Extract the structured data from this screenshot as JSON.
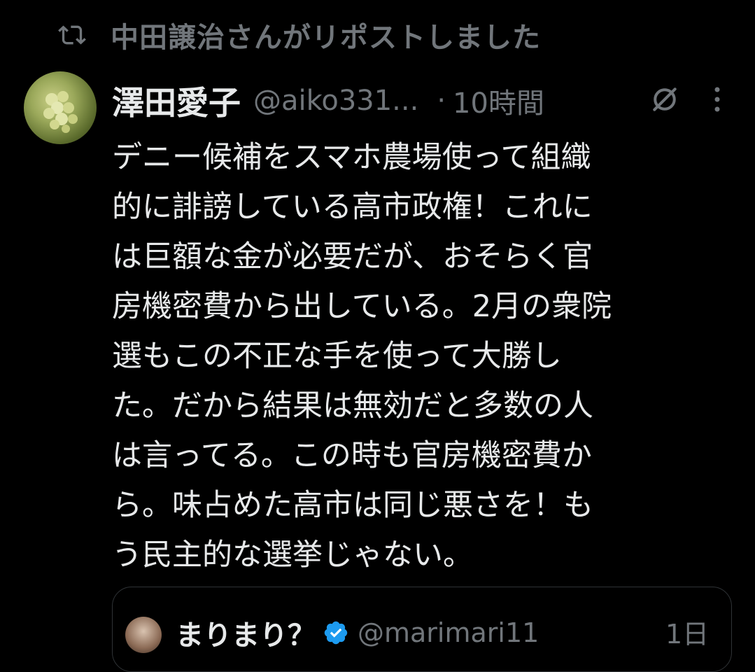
{
  "repost": {
    "text": "中田譲治さんがリポストしました"
  },
  "tweet": {
    "display_name": "澤田愛子",
    "handle": "@aiko331...",
    "separator": "·",
    "time": "10時間",
    "lines": [
      "デニー候補をスマホ農場使って組織",
      "的に誹謗している高市政権！これに",
      "は巨額な金が必要だが、おそらく官",
      "房機密費から出している。2月の衆院",
      "選もこの不正な手を使って大勝し",
      "た。だから結果は無効だと多数の人",
      "は言ってる。この時も官房機密費か",
      "ら。味占めた高市は同じ悪さを！も",
      "う民主的な選挙じゃない。"
    ]
  },
  "quote": {
    "display_name": "まりまり？",
    "handle": "@marimari11",
    "time": "1日"
  },
  "icons": {
    "repost": "repost-icon",
    "grok": "grok-icon",
    "more": "more-icon",
    "verified": "verified-badge-icon"
  },
  "colors": {
    "background": "#000000",
    "primary_text": "#e7e9ea",
    "secondary_text": "#71767b",
    "border": "#2f3336",
    "verified": "#1d9bf0"
  }
}
